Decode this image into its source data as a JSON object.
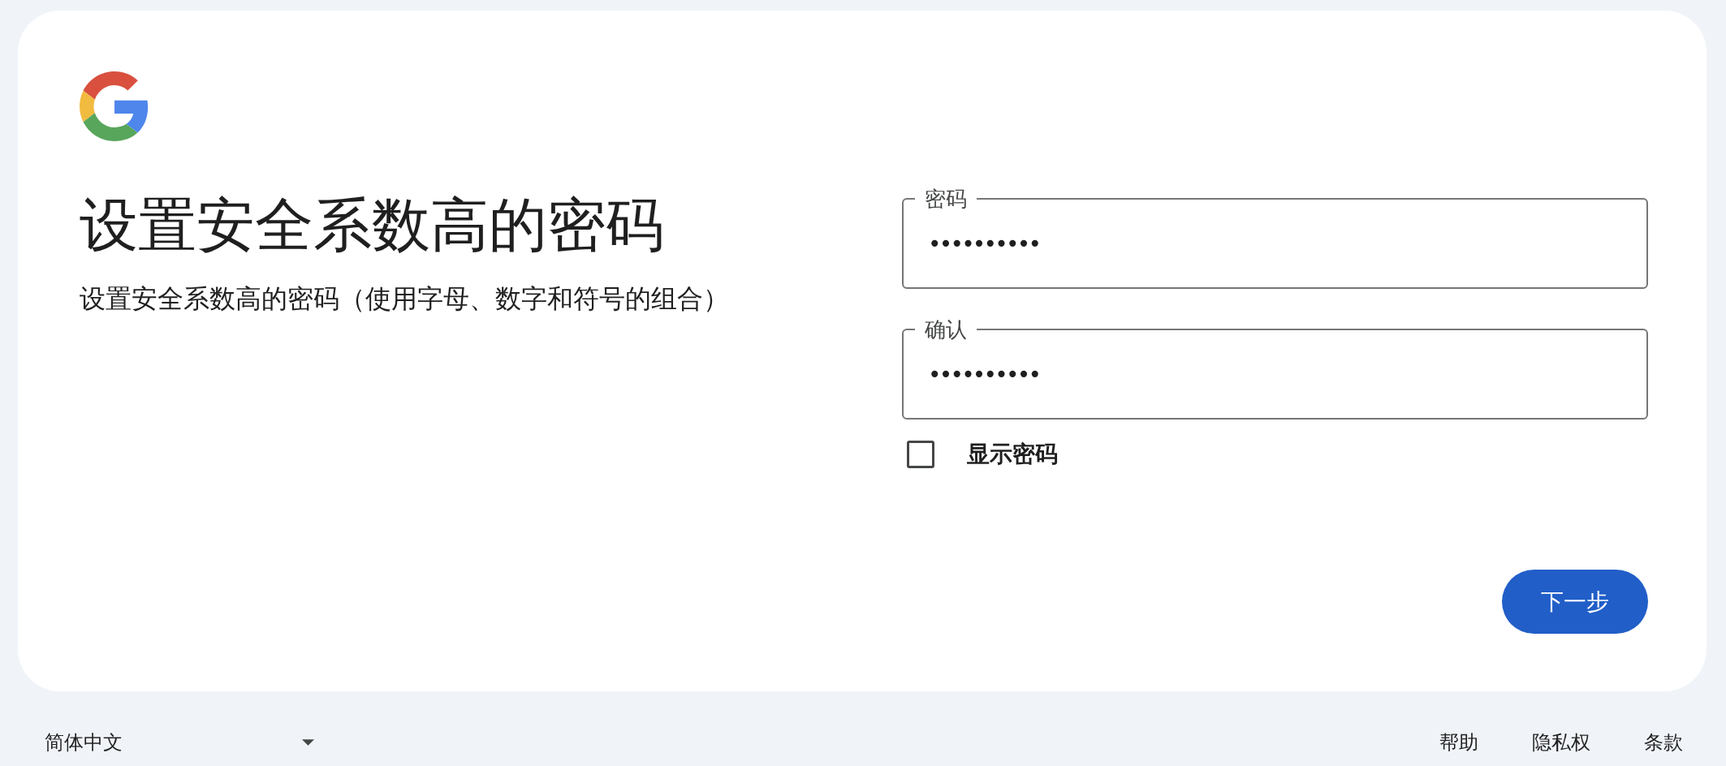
{
  "heading": "设置安全系数高的密码",
  "subtitle": "设置安全系数高的密码（使用字母、数字和符号的组合）",
  "fields": [
    {
      "label": "密码",
      "value": "••••••••••"
    },
    {
      "label": "确认",
      "value": "••••••••••"
    }
  ],
  "show_password": {
    "label": "显示密码",
    "checked": false
  },
  "next_button": "下一步",
  "footer": {
    "language": "简体中文",
    "links": [
      "帮助",
      "隐私权",
      "条款"
    ]
  }
}
